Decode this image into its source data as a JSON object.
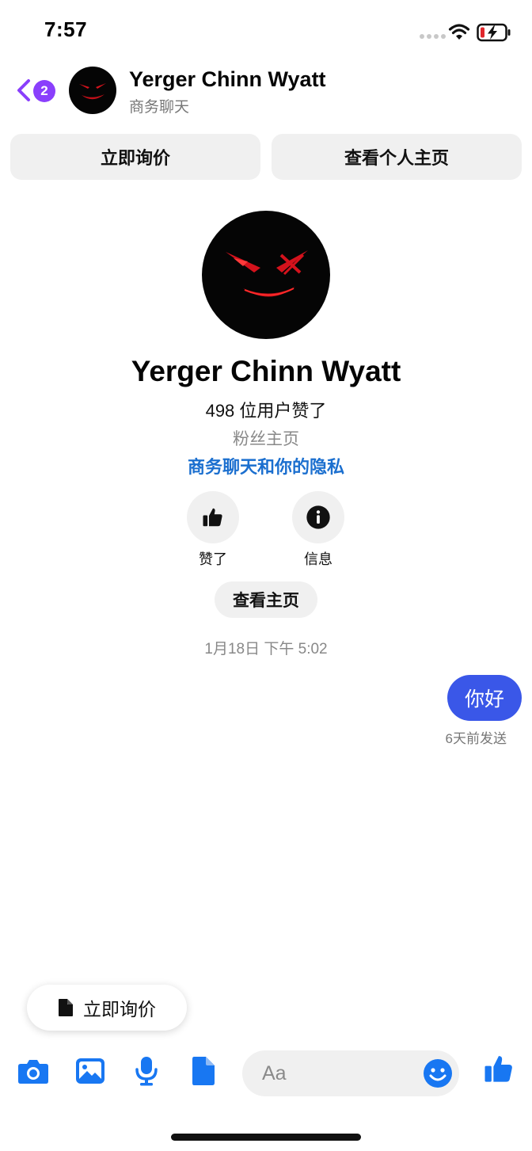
{
  "status_bar": {
    "time": "7:57"
  },
  "header": {
    "back_badge_count": "2",
    "name": "Yerger Chinn Wyatt",
    "subtitle": "商务聊天"
  },
  "actions": {
    "inquire_label": "立即询价",
    "view_profile_label": "查看个人主页"
  },
  "profile": {
    "name": "Yerger Chinn Wyatt",
    "likes_text": "498 位用户赞了",
    "page_type": "粉丝主页",
    "privacy_link": "商务聊天和你的隐私",
    "like_label": "赞了",
    "info_label": "信息",
    "view_page_label": "查看主页"
  },
  "conversation": {
    "timestamp": "1月18日 下午 5:02",
    "messages": [
      {
        "text": "你好",
        "status": "6天前发送"
      }
    ]
  },
  "quick_reply": {
    "label": "立即询价"
  },
  "composer": {
    "placeholder": "Aa"
  },
  "colors": {
    "accent_blue": "#3a57e8",
    "icon_blue": "#1877f2",
    "link_blue": "#1b6fcf",
    "badge_purple": "#8a3ffc",
    "battery_red": "#e0262b"
  },
  "icons": {
    "back": "chevron-left-icon",
    "camera": "camera-icon",
    "gallery": "image-icon",
    "microphone": "microphone-icon",
    "file": "file-icon",
    "emoji": "emoji-icon",
    "like": "thumbs-up-icon",
    "info": "info-icon"
  }
}
